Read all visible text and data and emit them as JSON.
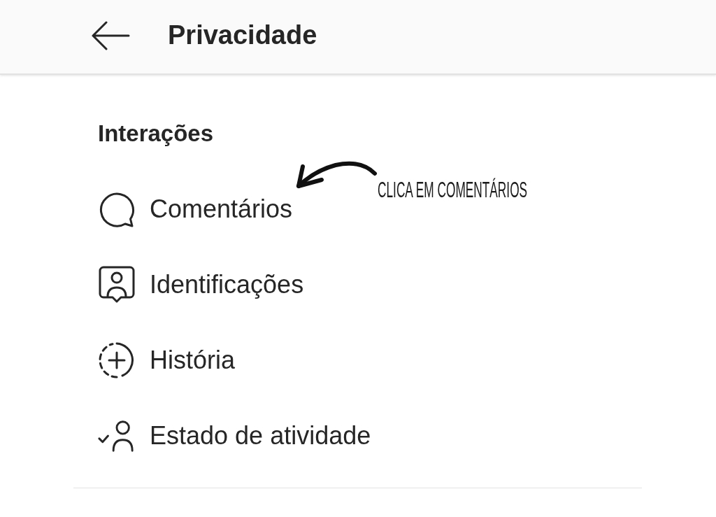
{
  "header": {
    "title": "Privacidade"
  },
  "section": {
    "heading": "Interações",
    "items": [
      {
        "label": "Comentários"
      },
      {
        "label": "Identificações"
      },
      {
        "label": "História"
      },
      {
        "label": "Estado de atividade"
      }
    ]
  },
  "annotation": {
    "text": "CLICA EM COMENTÁRIOS"
  }
}
